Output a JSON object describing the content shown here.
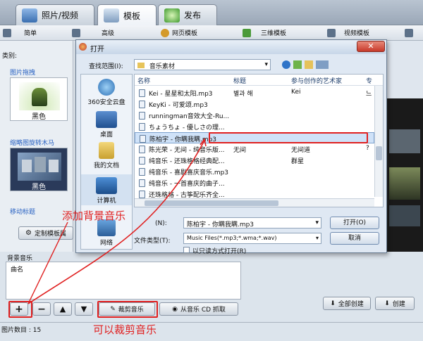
{
  "tabs": [
    {
      "label": "照片/视频"
    },
    {
      "label": "模板"
    },
    {
      "label": "发布"
    }
  ],
  "toolbar": {
    "items": [
      {
        "label": "简单"
      },
      {
        "label": "高级"
      },
      {
        "label": "网页模板"
      },
      {
        "label": "三维模板"
      },
      {
        "label": "视频模板"
      }
    ]
  },
  "left": {
    "category_label": "类别:",
    "sections": [
      {
        "title": "图片拖拽",
        "caption": "黑色"
      },
      {
        "title": "缩略图旋转木马",
        "caption": "黑色"
      },
      {
        "title": "移动标题"
      }
    ],
    "customize_button": "定制模板属"
  },
  "bottom": {
    "bg_music_label": "背景音乐",
    "col_song": "曲名",
    "crop_button": "裁剪音乐",
    "cd_button": "从音乐 CD 抓取",
    "create_all_button": "全部创建",
    "create_button": "创建",
    "image_count": "图片数目 : 15"
  },
  "dialog": {
    "title": "打开",
    "look_in_label": "查找范围(I):",
    "look_in_value": "音乐素材",
    "places": [
      {
        "label": "360安全云盘"
      },
      {
        "label": "桌面"
      },
      {
        "label": "我的文档"
      },
      {
        "label": "计算机"
      },
      {
        "label": "网络"
      }
    ],
    "columns": [
      "名称",
      "标题",
      "参与创作的艺术家",
      "专"
    ],
    "files": [
      {
        "name": "Kei - 星星和太阳.mp3",
        "title": "별과 해",
        "artist": "Kei",
        "album": "느"
      },
      {
        "name": "KeyKi - 可爱颂.mp3",
        "title": "",
        "artist": "",
        "album": ""
      },
      {
        "name": "runningman音效大全-Ru...",
        "title": "",
        "artist": "",
        "album": ""
      },
      {
        "name": "ちょうちょ - 優しさの理...",
        "title": "",
        "artist": "",
        "album": ""
      },
      {
        "name": "陈柏宇 - 你瞒我瞒.mp3",
        "title": "",
        "artist": "",
        "album": ""
      },
      {
        "name": "陈光荣 - 无间 - 纯音乐版...",
        "title": "无间",
        "artist": "无间道",
        "album": "?"
      },
      {
        "name": "纯音乐 - 还珠格格经典配...",
        "title": "",
        "artist": "群星",
        "album": ""
      },
      {
        "name": "纯音乐 - 喜剧喜庆音乐.mp3",
        "title": "",
        "artist": "",
        "album": ""
      },
      {
        "name": "纯音乐 - 一首喜庆的曲子...",
        "title": "",
        "artist": "",
        "album": ""
      },
      {
        "name": "还珠格格 - 古筝配乐齐全...",
        "title": "",
        "artist": "",
        "album": ""
      }
    ],
    "filename_label": "(N):",
    "filename_value": "陈柏宇 - 你瞒我瞒.mp3",
    "filetype_label": "文件类型(T):",
    "filetype_value": "Music Files(*.mp3;*.wma;*.wav)",
    "readonly_label": "以只读方式打开(R)",
    "open_button": "打开(O)",
    "cancel_button": "取消"
  },
  "annotations": {
    "add_music": "添加背景音乐",
    "crop_music": "可以裁剪音乐"
  },
  "colors": {
    "accent": "#e02020",
    "selection": "#cfe2f8"
  }
}
